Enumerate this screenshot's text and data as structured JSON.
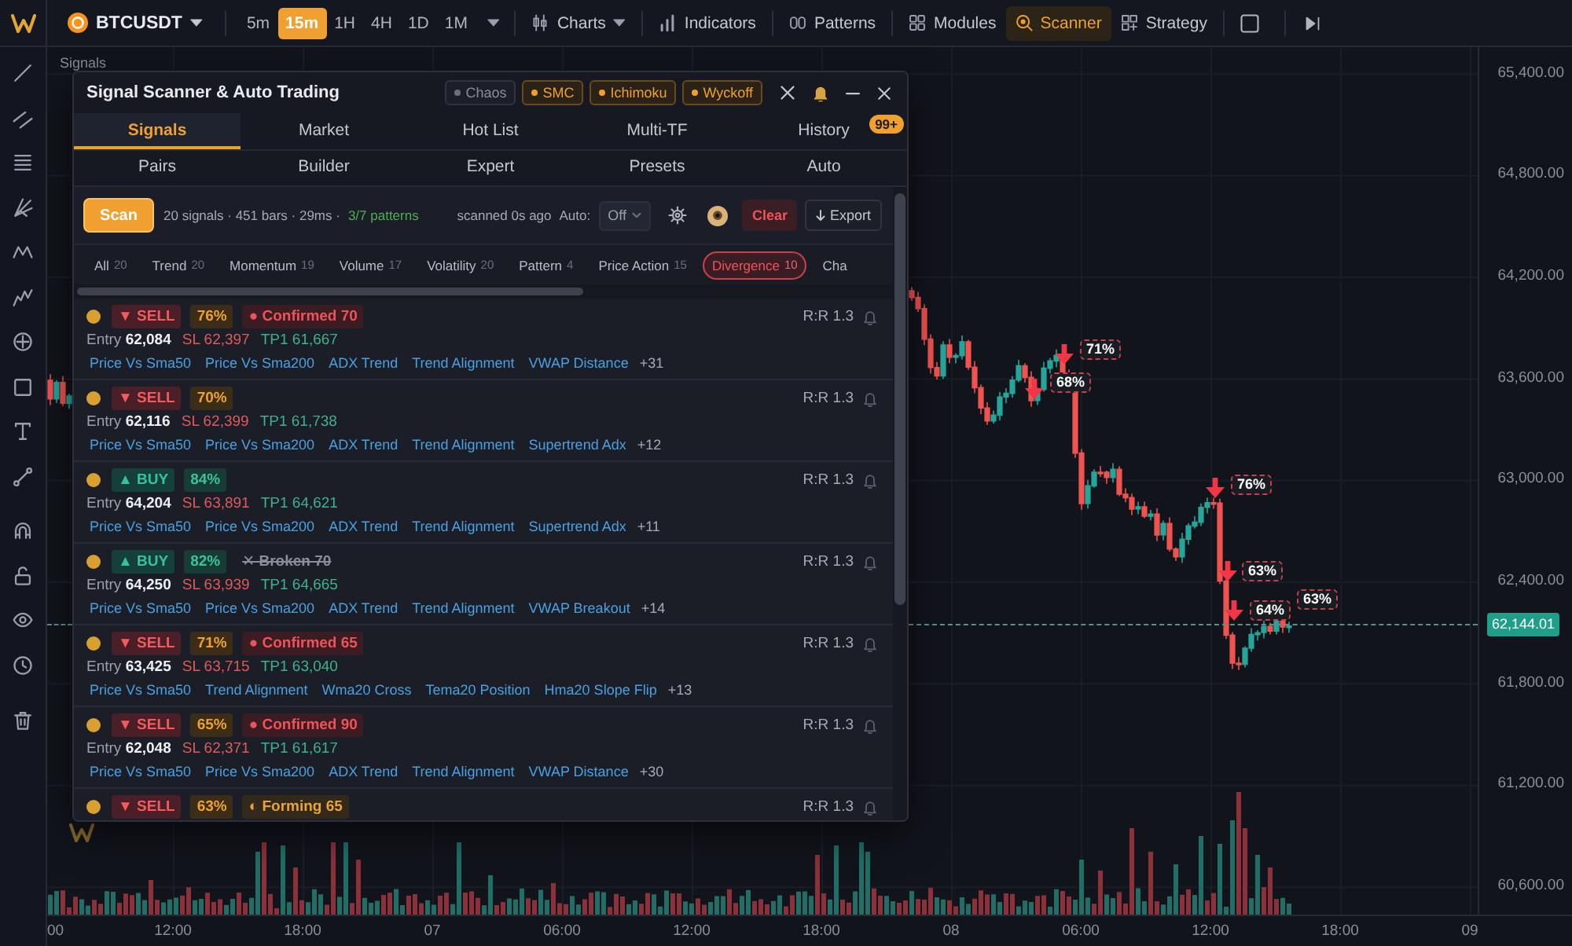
{
  "toolbar": {
    "symbol": "BTCUSDT",
    "timeframes": [
      {
        "label": "5m",
        "selected": false
      },
      {
        "label": "15m",
        "selected": true
      },
      {
        "label": "1H",
        "selected": false
      },
      {
        "label": "4H",
        "selected": false
      },
      {
        "label": "1D",
        "selected": false
      },
      {
        "label": "1M",
        "selected": false
      }
    ],
    "menus": [
      {
        "label": "Charts",
        "selected": false,
        "dropdown": true
      },
      {
        "label": "Indicators",
        "selected": false,
        "dropdown": false
      },
      {
        "label": "Patterns",
        "selected": false,
        "dropdown": false
      },
      {
        "label": "Modules",
        "selected": false,
        "dropdown": false
      },
      {
        "label": "Scanner",
        "selected": true,
        "dropdown": false
      },
      {
        "label": "Strategy",
        "selected": false,
        "dropdown": false
      }
    ]
  },
  "chart": {
    "pane_label": "Signals",
    "price_axis": [
      "65,400.00",
      "64,800.00",
      "64,200.00",
      "63,600.00",
      "63,000.00",
      "62,400.00",
      "61,800.00",
      "61,200.00",
      "60,600.00"
    ],
    "last_price": "62,144.01",
    "time_axis": [
      "00",
      "12:00",
      "18:00",
      "07",
      "06:00",
      "12:00",
      "18:00",
      "08",
      "06:00",
      "12:00",
      "18:00",
      "09"
    ],
    "signal_markers": [
      {
        "label": "71%"
      },
      {
        "label": "68%"
      },
      {
        "label": "76%"
      },
      {
        "label": "63%"
      },
      {
        "label": "63%"
      },
      {
        "label": "64%"
      }
    ]
  },
  "scanner": {
    "title": "Signal Scanner & Auto Trading",
    "modes": [
      {
        "label": "Chaos",
        "on": false
      },
      {
        "label": "SMC",
        "on": true
      },
      {
        "label": "Ichimoku",
        "on": true
      },
      {
        "label": "Wyckoff",
        "on": true
      }
    ],
    "tabs": [
      {
        "label": "Signals",
        "selected": true
      },
      {
        "label": "Market",
        "selected": false
      },
      {
        "label": "Hot List",
        "selected": false
      },
      {
        "label": "Multi-TF",
        "selected": false
      },
      {
        "label": "History",
        "selected": false,
        "badge": "99+"
      }
    ],
    "subtabs": [
      {
        "label": "Pairs",
        "selected": false
      },
      {
        "label": "Builder",
        "selected": false
      },
      {
        "label": "Expert",
        "selected": false
      },
      {
        "label": "Presets",
        "selected": false
      },
      {
        "label": "Auto",
        "selected": false
      }
    ],
    "scan_button": "Scan",
    "summary": "20 signals · 451 bars · 29ms ·",
    "patterns": "3/7 patterns",
    "scanned": "scanned 0s ago",
    "auto_label": "Auto:",
    "auto_value": "Off",
    "clear_button": "Clear",
    "export_button": "Export",
    "categories": [
      {
        "label": "All",
        "count": "20",
        "selected": false
      },
      {
        "label": "Trend",
        "count": "20",
        "selected": false
      },
      {
        "label": "Momentum",
        "count": "19",
        "selected": false
      },
      {
        "label": "Volume",
        "count": "17",
        "selected": false
      },
      {
        "label": "Volatility",
        "count": "20",
        "selected": false
      },
      {
        "label": "Pattern",
        "count": "4",
        "selected": false
      },
      {
        "label": "Price Action",
        "count": "15",
        "selected": false
      },
      {
        "label": "Divergence",
        "count": "10",
        "selected": true
      },
      {
        "label": "Cha",
        "selected": false
      }
    ],
    "signals": [
      {
        "kind": "sell",
        "side": "▼ SELL",
        "confidence": "76%",
        "status": {
          "kind": "confirmed",
          "label": "● Confirmed 70"
        },
        "entry": "Entry **62,084**",
        "stop_loss": "SL 62,397",
        "take_profit": "TP1 61,667",
        "indicators": [
          "Price Vs Sma50",
          "Price Vs Sma200",
          "ADX Trend",
          "Trend Alignment",
          "VWAP Distance"
        ],
        "more": "+31",
        "risk_reward": "R:R 1.3"
      },
      {
        "kind": "sell",
        "side": "▼ SELL",
        "confidence": "70%",
        "entry": "Entry **62,116**",
        "stop_loss": "SL 62,399",
        "take_profit": "TP1 61,738",
        "indicators": [
          "Price Vs Sma50",
          "Price Vs Sma200",
          "ADX Trend",
          "Trend Alignment",
          "Supertrend Adx"
        ],
        "more": "+12",
        "risk_reward": "R:R 1.3"
      },
      {
        "kind": "buy",
        "side": "▲ BUY",
        "confidence": "84%",
        "entry": "Entry **64,204**",
        "stop_loss": "SL 63,891",
        "take_profit": "TP1 64,621",
        "indicators": [
          "Price Vs Sma50",
          "Price Vs Sma200",
          "ADX Trend",
          "Trend Alignment",
          "Supertrend Adx"
        ],
        "more": "+11",
        "risk_reward": "R:R 1.3"
      },
      {
        "kind": "buy",
        "side": "▲ BUY",
        "confidence": "82%",
        "status": {
          "kind": "broken",
          "label": "✕ Broken 70"
        },
        "entry": "Entry **64,250**",
        "stop_loss": "SL 63,939",
        "take_profit": "TP1 64,665",
        "indicators": [
          "Price Vs Sma50",
          "Price Vs Sma200",
          "ADX Trend",
          "Trend Alignment",
          "VWAP Breakout"
        ],
        "more": "+14",
        "risk_reward": "R:R 1.3"
      },
      {
        "kind": "sell",
        "side": "▼ SELL",
        "confidence": "71%",
        "status": {
          "kind": "confirmed",
          "label": "● Confirmed 65"
        },
        "entry": "Entry **63,425**",
        "stop_loss": "SL 63,715",
        "take_profit": "TP1 63,040",
        "indicators": [
          "Price Vs Sma50",
          "Trend Alignment",
          "Wma20 Cross",
          "Tema20 Position",
          "Hma20 Slope Flip"
        ],
        "more": "+13",
        "risk_reward": "R:R 1.3"
      },
      {
        "kind": "sell",
        "side": "▼ SELL",
        "confidence": "65%",
        "status": {
          "kind": "confirmed",
          "label": "● Confirmed 90"
        },
        "entry": "Entry **62,048**",
        "stop_loss": "SL 62,371",
        "take_profit": "TP1 61,617",
        "indicators": [
          "Price Vs Sma50",
          "Price Vs Sma200",
          "ADX Trend",
          "Trend Alignment",
          "VWAP Distance"
        ],
        "more": "+30",
        "risk_reward": "R:R 1.3"
      },
      {
        "kind": "sell",
        "side": "▼ SELL",
        "confidence": "63%",
        "status": {
          "kind": "forming",
          "label": "◐ Forming 65"
        },
        "risk_reward": "R:R 1.3"
      }
    ]
  }
}
